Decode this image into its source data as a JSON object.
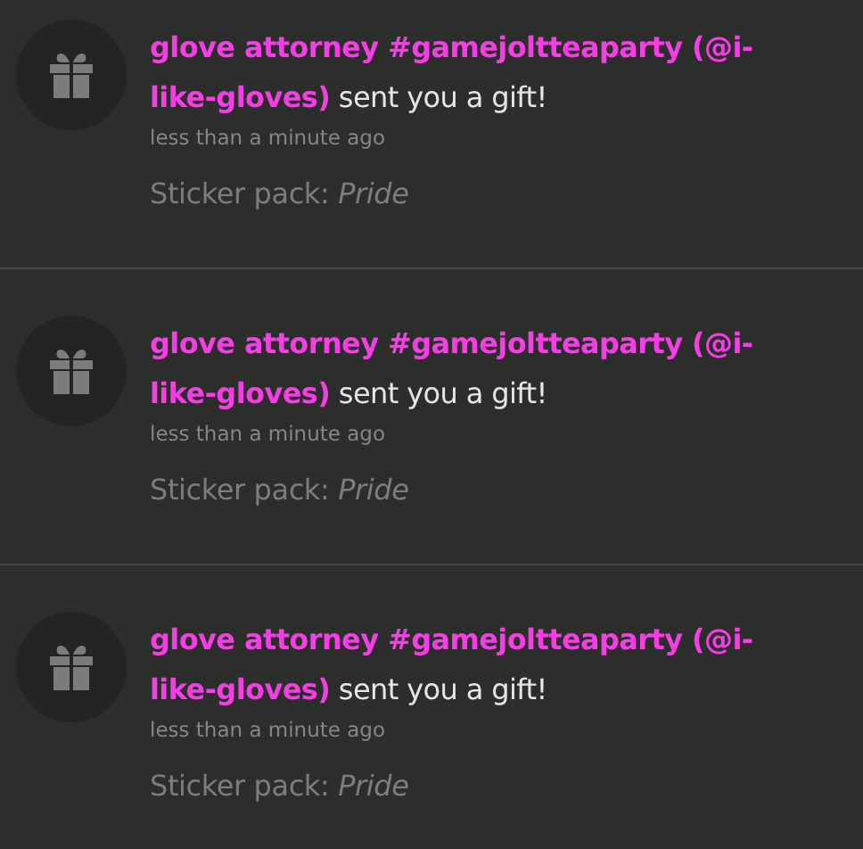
{
  "notifications": [
    {
      "sender": "glove attorney #gamejoltteaparty (@i-like-gloves)",
      "message": "sent you a gift!",
      "time": "less than a minute ago",
      "detail": "Sticker pack: *Pride*"
    },
    {
      "sender": "glove attorney #gamejoltteaparty (@i-like-gloves)",
      "message": "sent you a gift!",
      "time": "less than a minute ago",
      "detail": "Sticker pack: *Pride*"
    },
    {
      "sender": "glove attorney #gamejoltteaparty (@i-like-gloves)",
      "message": "sent you a gift!",
      "time": "less than a minute ago",
      "detail": "Sticker pack: *Pride*"
    }
  ]
}
